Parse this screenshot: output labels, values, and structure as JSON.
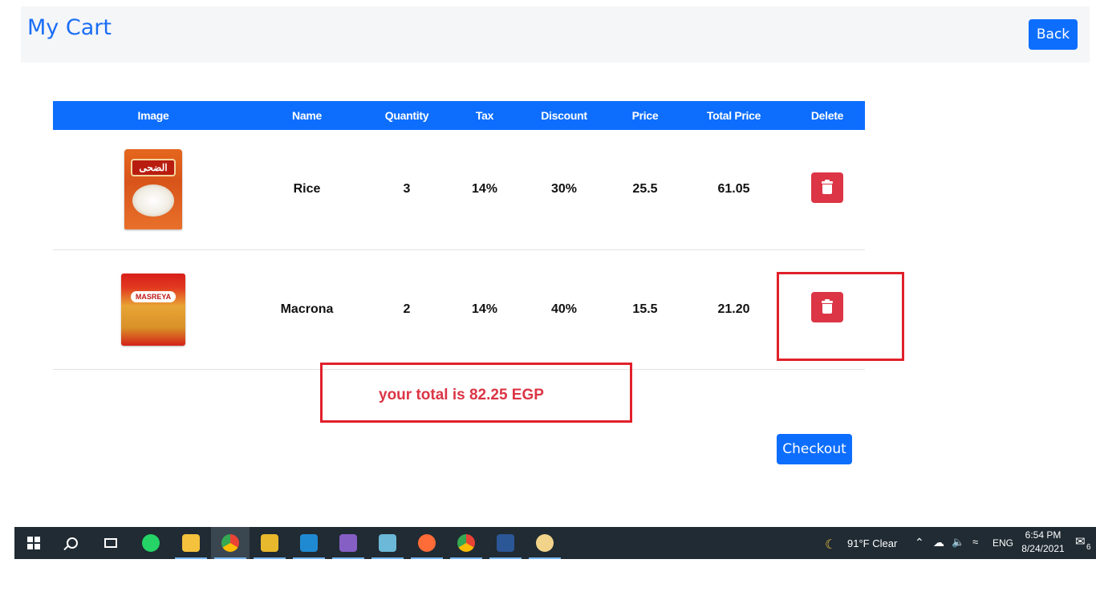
{
  "header": {
    "title": "My Cart",
    "back_label": "Back"
  },
  "table": {
    "columns": [
      "Image",
      "Name",
      "Quantity",
      "Tax",
      "Discount",
      "Price",
      "Total Price",
      "Delete"
    ],
    "rows": [
      {
        "image_icon": "rice-bag-image",
        "name": "Rice",
        "quantity": "3",
        "tax": "14%",
        "discount": "30%",
        "price": "25.5",
        "total_price": "61.05"
      },
      {
        "image_icon": "pasta-bag-image",
        "name": "Macrona",
        "quantity": "2",
        "tax": "14%",
        "discount": "40%",
        "price": "15.5",
        "total_price": "21.20"
      }
    ]
  },
  "total": {
    "text": "your total is 82.25 EGP"
  },
  "checkout": {
    "label": "Checkout"
  },
  "colors": {
    "primary": "#0d6efd",
    "danger": "#dc3545",
    "highlight": "#e0202a",
    "taskbar": "#202b33"
  },
  "taskbar": {
    "apps": [
      "windows-start-icon",
      "search-icon",
      "task-view-icon",
      "whatsapp-icon",
      "file-explorer-icon",
      "chrome-icon",
      "spreadsheet-app-icon",
      "vscode-icon",
      "visual-studio-icon",
      "notes-app-icon",
      "postman-icon",
      "chrome-icon",
      "word-icon",
      "paint-icon"
    ],
    "weather": {
      "icon": "moon-icon",
      "text": "91°F  Clear"
    },
    "language": "ENG",
    "time": "6:54 PM",
    "date": "8/24/2021",
    "notification_count": "6"
  }
}
